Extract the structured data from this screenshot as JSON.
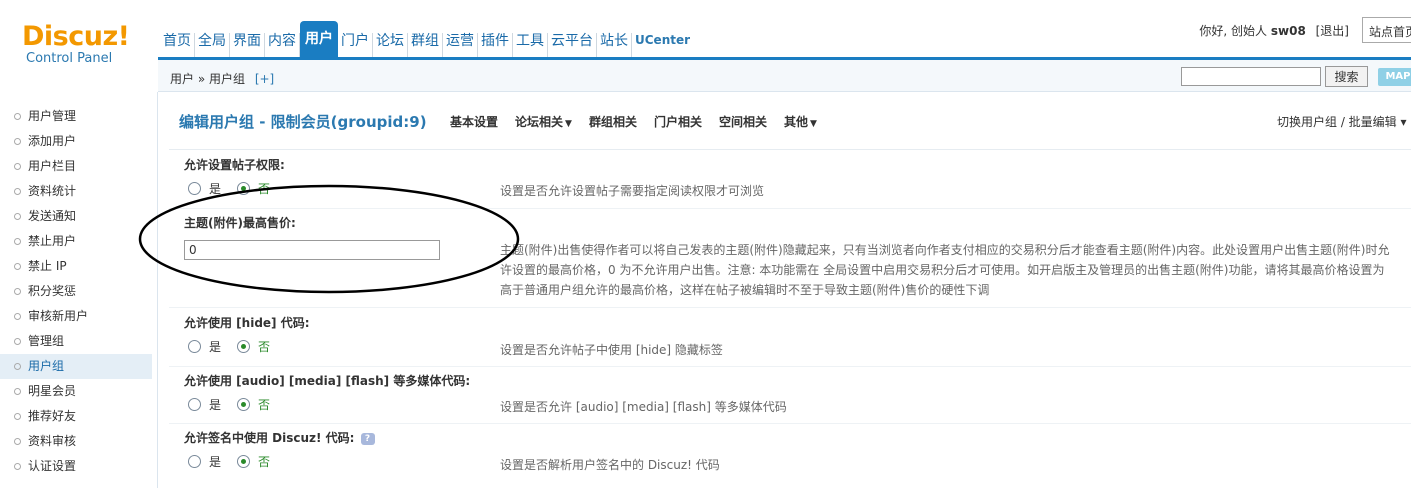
{
  "header": {
    "logo_brand": "Discuz!",
    "logo_sub": "Control Panel",
    "nav": [
      "首页",
      "全局",
      "界面",
      "内容",
      "用户",
      "门户",
      "论坛",
      "群组",
      "运营",
      "插件",
      "工具",
      "云平台",
      "站长",
      "UCenter"
    ],
    "nav_active_index": 4,
    "greeting": "你好, 创始人",
    "username": "sw08",
    "logout": "[退出]",
    "site_home": "站点首页"
  },
  "subbar": {
    "breadcrumb": "用户 » 用户组",
    "plus": "[+]",
    "search_value": "",
    "search_button": "搜索",
    "map_button": "MAP"
  },
  "sidebar": {
    "items": [
      "用户管理",
      "添加用户",
      "用户栏目",
      "资料统计",
      "发送通知",
      "禁止用户",
      "禁止 IP",
      "积分奖惩",
      "审核新用户",
      "管理组",
      "用户组",
      "明星会员",
      "推荐好友",
      "资料审核",
      "认证设置"
    ],
    "active_index": 10
  },
  "main": {
    "title": "编辑用户组 - 限制会员(groupid:9)",
    "tabs": [
      {
        "label": "基本设置",
        "arrow": ""
      },
      {
        "label": "论坛相关",
        "arrow": "▼"
      },
      {
        "label": "群组相关",
        "arrow": ""
      },
      {
        "label": "门户相关",
        "arrow": ""
      },
      {
        "label": "空间相关",
        "arrow": ""
      },
      {
        "label": "其他",
        "arrow": "▼"
      }
    ],
    "switch_link": "切换用户组 / 批量编辑 ▾",
    "radio_yes": "是",
    "radio_no": "否",
    "settings": [
      {
        "label": "允许设置帖子权限:",
        "value": "否",
        "desc": "设置是否允许设置帖子需要指定阅读权限才可浏览"
      },
      {
        "label": "主题(附件)最高售价:",
        "input_value": "0",
        "desc_lines": [
          "主题(附件)出售使得作者可以将自己发表的主题(附件)隐藏起来，只有当浏览者向作者支付相应的交易积分后才能查看主题(附件)内容。此处设置用户出售主题(附件)时允",
          "许设置的最高价格，0 为不允许用户出售。注意: 本功能需在 全局设置中启用交易积分后才可使用。如开启版主及管理员的出售主题(附件)功能，请将其最高价格设置为",
          "高于普通用户组允许的最高价格，这样在帖子被编辑时不至于导致主题(附件)售价的硬性下调"
        ]
      },
      {
        "label": "允许使用 [hide] 代码:",
        "value": "否",
        "desc": "设置是否允许帖子中使用 [hide] 隐藏标签"
      },
      {
        "label": "允许使用 [audio] [media] [flash] 等多媒体代码:",
        "value": "否",
        "desc": "设置是否允许 [audio] [media] [flash] 等多媒体代码"
      },
      {
        "label": "允许签名中使用 Discuz! 代码:",
        "value": "否",
        "desc": "设置是否解析用户签名中的 Discuz! 代码"
      }
    ]
  }
}
